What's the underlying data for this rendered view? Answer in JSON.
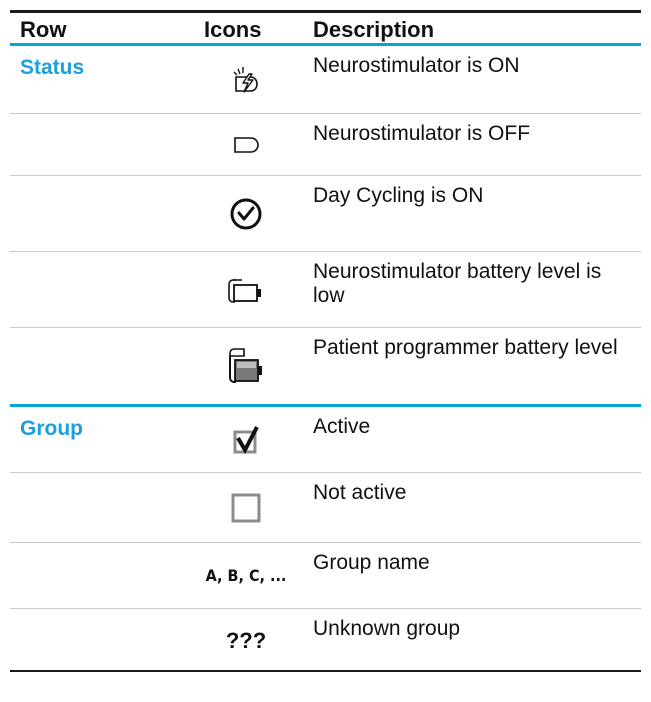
{
  "header": {
    "col_row": "Row",
    "col_icons": "Icons",
    "col_description": "Description"
  },
  "groups": [
    {
      "label": "Status",
      "rows": [
        {
          "icon": "stimulator-on-icon",
          "description": "Neurostimulator is ON"
        },
        {
          "icon": "stimulator-off-icon",
          "description": "Neurostimulator is OFF"
        },
        {
          "icon": "day-cycling-icon",
          "description": "Day Cycling is ON"
        },
        {
          "icon": "stimulator-battery-low-icon",
          "description": "Neurostimulator battery level is low"
        },
        {
          "icon": "programmer-battery-icon",
          "description": "Patient programmer battery level"
        }
      ]
    },
    {
      "label": "Group",
      "rows": [
        {
          "icon": "checkbox-checked-icon",
          "description": "Active"
        },
        {
          "icon": "checkbox-empty-icon",
          "description": "Not active"
        },
        {
          "icon_text": "A, B, C, ...",
          "description": "Group name"
        },
        {
          "icon_text": "???",
          "description": "Unknown group"
        }
      ]
    }
  ],
  "colors": {
    "accent_blue": "#1ba0dd",
    "rule_blue": "#00a6d6",
    "rule_dark": "#1a1a1a"
  }
}
